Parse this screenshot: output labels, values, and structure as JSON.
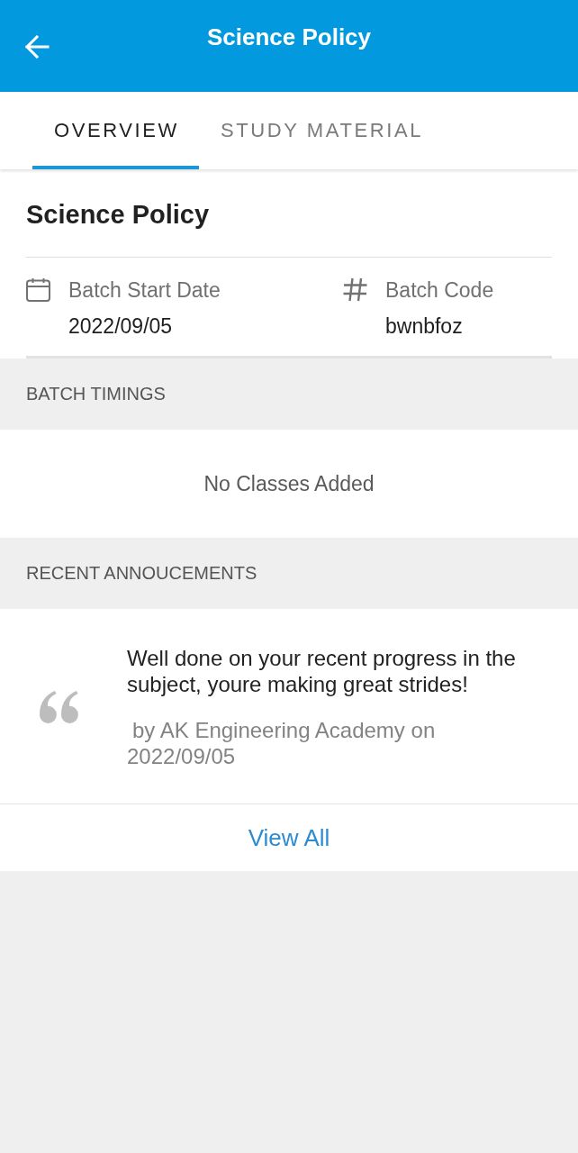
{
  "app_bar": {
    "title": "Science Policy"
  },
  "tabs": [
    {
      "label": "OVERVIEW",
      "selected": true
    },
    {
      "label": "STUDY MATERIAL",
      "selected": false
    }
  ],
  "course": {
    "title": "Science Policy",
    "details": [
      {
        "kind": "date",
        "label": "Batch Start Date",
        "value": "2022/09/05"
      },
      {
        "kind": "code",
        "label": "Batch Code",
        "value": "bwnbfoz"
      }
    ]
  },
  "batch_timings": {
    "heading": "BATCH TIMINGS",
    "empty_text": "No Classes Added"
  },
  "recent_announcements": {
    "heading": "RECENT ANNOUCEMENTS",
    "items": [
      {
        "message": "Well done on your recent progress in the subject, youre making great strides!",
        "byline": "by AK Engineering Academy on 2022/09/05"
      }
    ],
    "view_all": "View All"
  }
}
